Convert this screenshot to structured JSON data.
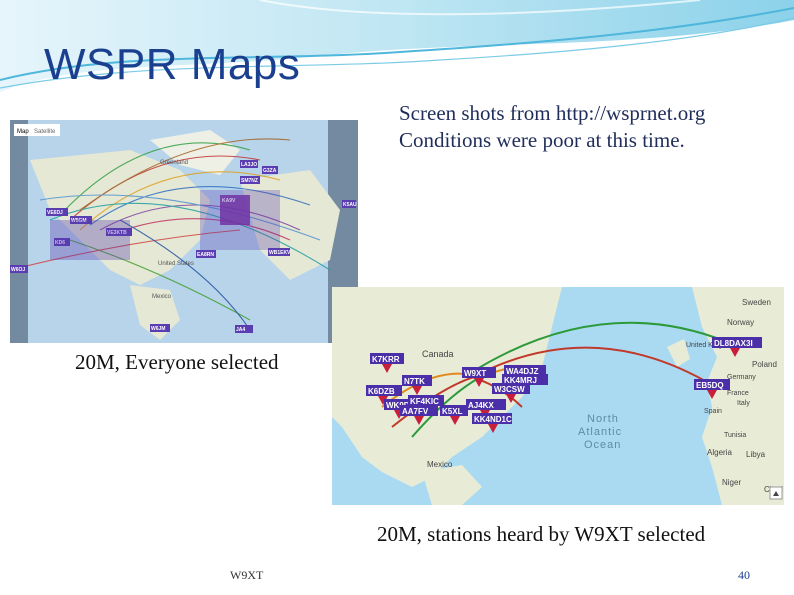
{
  "slide": {
    "title": "WSPR Maps",
    "caption_right_line1": "Screen shots from http://wsprnet.org",
    "caption_right_line2": "Conditions were poor at this time.",
    "map1_caption": "20M, Everyone selected",
    "map2_caption": "20M, stations heard by W9XT selected",
    "footer_left": "W9XT",
    "page_number": "40"
  },
  "map1": {
    "tabs": [
      "Map",
      "Satellite"
    ],
    "labels": [
      "Greenland",
      "United States",
      "Mexico"
    ],
    "pins": [
      "LA3JO",
      "G3ZA",
      "SM7NZ",
      "KA9V",
      "EA8RN",
      "WB1EKV",
      "W6JM",
      "JA4",
      "K5AU",
      "VE6DJ",
      "W5GM",
      "W6OJ",
      "VE3KTB",
      "KD6"
    ]
  },
  "map2": {
    "labels": [
      "Canada",
      "Sweden",
      "Norway",
      "United Kingdom",
      "Poland",
      "Germany",
      "France",
      "Spain",
      "Italy",
      "North",
      "Atlantic",
      "Ocean",
      "Mexico",
      "Algeria",
      "Libya",
      "Niger",
      "Tunisia",
      "Chad"
    ],
    "pins": [
      "K7KRR",
      "N7TK",
      "W9XT",
      "W3CSW",
      "K6DZB",
      "WK9D",
      "KF4KIC",
      "AA7FV",
      "K5XL",
      "WA4DJZ",
      "KK4MRJ",
      "AJ4KX",
      "KK4ND1C",
      "DL8DAX3I",
      "EB5DQ"
    ]
  },
  "colors": {
    "title": "#1a3f8f",
    "pin": "#c8203b",
    "water": "#aadaf2",
    "land": "#e8ecd6"
  }
}
